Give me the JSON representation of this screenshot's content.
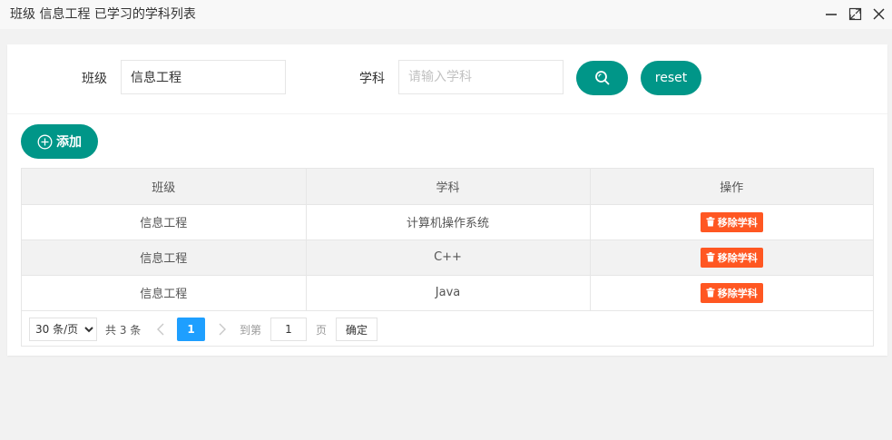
{
  "window": {
    "title": "班级 信息工程 已学习的学科列表",
    "icons": [
      "minimize-icon",
      "maximize-icon",
      "close-icon"
    ]
  },
  "search": {
    "class_label": "班级",
    "class_value": "信息工程",
    "subject_label": "学科",
    "subject_value": "",
    "subject_placeholder": "请输入学科",
    "search_icon": "search-icon",
    "reset_label": "reset"
  },
  "toolbar": {
    "add_label": "添加",
    "add_icon": "plus-circle-icon"
  },
  "table": {
    "headers": [
      "班级",
      "学科",
      "操作"
    ],
    "rows": [
      {
        "class": "信息工程",
        "subject": "计算机操作系统",
        "action": "移除学科"
      },
      {
        "class": "信息工程",
        "subject": "C++",
        "action": "移除学科"
      },
      {
        "class": "信息工程",
        "subject": "Java",
        "action": "移除学科"
      }
    ],
    "action_icon": "trash-icon"
  },
  "pagination": {
    "page_size_selected": "30 条/页",
    "page_size_options": [
      "30 条/页"
    ],
    "total_text": "共 3 条",
    "current_page": "1",
    "goto_label": "到第",
    "goto_value": "1",
    "page_label": "页",
    "confirm_label": "确定"
  },
  "colors": {
    "primary": "#009688",
    "danger": "#ff5722",
    "pager_active": "#1e9fff",
    "page_bg": "#f2f2f2"
  }
}
